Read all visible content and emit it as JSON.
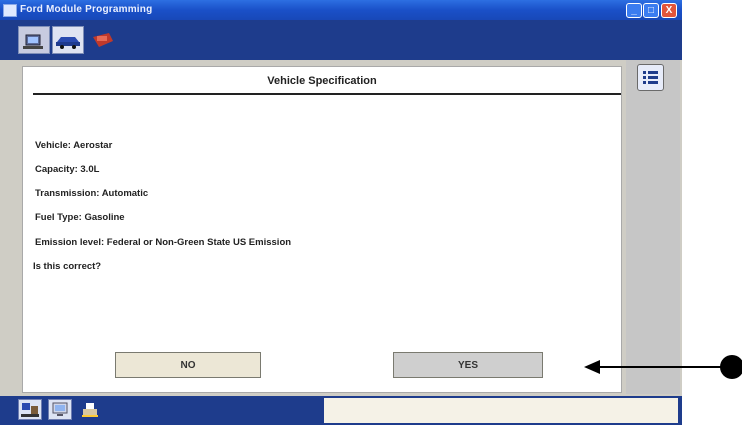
{
  "window": {
    "title": "Ford Module Programming"
  },
  "titlebar_buttons": {
    "minimize": "_",
    "maximize": "□",
    "close": "X"
  },
  "toolbar": {
    "icons": [
      "computer-tool-icon",
      "vehicle-icon",
      "engine-icon"
    ]
  },
  "panel": {
    "title": "Vehicle Specification",
    "vehicle": "Vehicle:  Aerostar",
    "capacity": "Capacity:  3.0L",
    "transmission": "Transmission:  Automatic",
    "fuel_type": "Fuel Type:  Gasoline",
    "emission_level": "Emission level:  Federal or Non-Green State US Emission",
    "question": "Is this correct?",
    "no_label": "NO",
    "yes_label": "YES"
  },
  "sidebar": {
    "icon": "list-icon"
  },
  "bottombar": {
    "icons": [
      "workstation-icon",
      "monitor-icon",
      "print-icon"
    ]
  },
  "annotation": {
    "arrow": "pointer-arrow"
  }
}
